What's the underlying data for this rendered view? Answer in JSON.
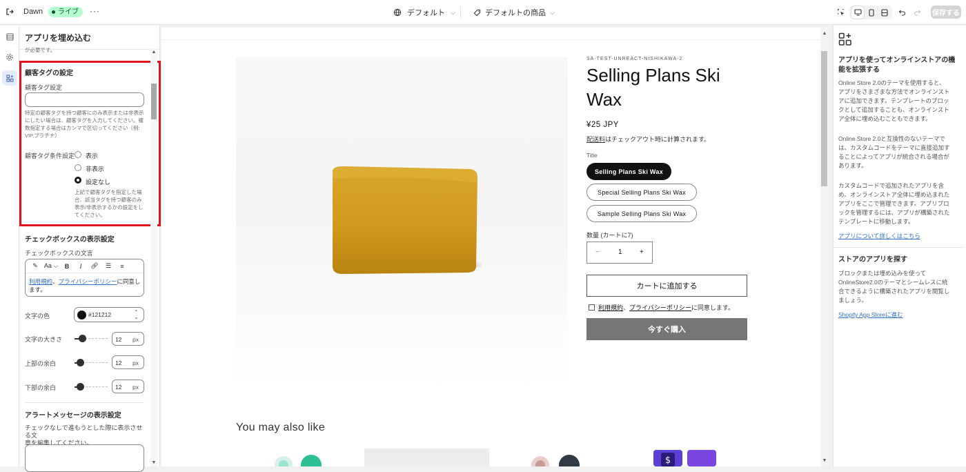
{
  "topbar": {
    "exit_icon": "exit-icon",
    "theme_name": "Dawn",
    "live_badge": "ライブ",
    "more_label": "···",
    "template_selector": "デフォルト",
    "product_selector": "デフォルトの商品",
    "save_label": "保存する"
  },
  "rail": {
    "items": [
      {
        "icon": "sections-icon",
        "active": false
      },
      {
        "icon": "settings-gear-icon",
        "active": false
      },
      {
        "icon": "app-embeds-icon",
        "active": true
      }
    ]
  },
  "left_panel": {
    "title": "アプリを埋め込む",
    "clipped_text": "が必要です。",
    "customer_tag": {
      "heading": "顧客タグの設定",
      "field_label": "顧客タグ設定",
      "field_value": "",
      "help_lines": [
        "特定の顧客タグを持つ顧客にのみ表示または非表示",
        "にしたい場合は、顧客タグを入力してください。複",
        "数指定する場合はカンマで区切ってください（例:",
        "VIP,プラチナ）"
      ],
      "condition_label": "顧客タグ条件設定",
      "options": [
        "表示",
        "非表示",
        "設定なし"
      ],
      "selected": "設定なし",
      "condition_help_lines": [
        "上記で顧客タグを指定した場",
        "合、該当タグを持つ顧客のみ",
        "表示/非表示するかの設定をし",
        "てください。"
      ]
    },
    "checkbox": {
      "heading": "チェックボックスの表示設定",
      "text_label": "チェックボックスの文言",
      "toolbar": [
        "magic-icon",
        "Aa",
        "B",
        "I",
        "link-icon",
        "bullet-list-icon",
        "numbered-list-icon"
      ],
      "link1": "利用規約",
      "sep": "、",
      "link2": "プライバシーポリシー",
      "suffix": "に同意し",
      "suffix2": "ます。",
      "color_label": "文字の色",
      "color_value": "#121212",
      "size_label": "文字の大きさ",
      "size_value": "12",
      "top_margin_label": "上部の余白",
      "top_margin_value": "12",
      "bottom_margin_label": "下部の余白",
      "bottom_margin_value": "12",
      "unit": "px"
    },
    "alert": {
      "heading": "アラートメッセージの表示設定",
      "help_lines": [
        "チェックなしで進もうとした際に表示させる文",
        "章を編集してください。"
      ]
    }
  },
  "product": {
    "vendor": "SA-TEST-UNREACT-NISHIKAWA-2",
    "title_line1": "Selling Plans Ski",
    "title_line2": "Wax",
    "price": "¥25 JPY",
    "shipping_link": "配送料",
    "shipping_rest": "はチェックアウト時に計算されます。",
    "option_label": "Title",
    "options": [
      "Selling Plans Ski Wax",
      "Special Selling Plans Ski Wax",
      "Sample Selling Plans Ski Wax"
    ],
    "selected_option": "Selling Plans Ski Wax",
    "qty_label": "数量 (カートに7)",
    "qty_minus": "−",
    "qty_value": "1",
    "qty_plus": "+",
    "add_to_cart": "カートに追加する",
    "agree_link1": "利用規約",
    "agree_sep": "、",
    "agree_link2": "プライバシーポリシー",
    "agree_suffix": "に同意します。",
    "buy_now": "今すぐ購入",
    "may_also_like": "You may also like",
    "wax_color": "#d8a629"
  },
  "right_panel": {
    "heading1_line1": "アプリを使ってオンラインストアの機",
    "heading1_line2": "能を拡張する",
    "para1": [
      "Online Store 2.0のテーマを使用すると、",
      "アプリをさまざまな方法でオンラインスト",
      "アに追加できます。テンプレートのブロッ",
      "クとして追加することも、オンラインスト",
      "ア全体に埋め込むこともできます。"
    ],
    "para2": [
      "Online Store 2.0と互換性のないテーマで",
      "は、カスタムコードをテーマに直接追加す",
      "ることによってアプリが統合される場合が",
      "あります。"
    ],
    "para3": [
      "カスタムコードで追加されたアプリを含",
      "め、オンラインストア全体に埋め込まれた",
      "アプリをここで管理できます。アプリブロ",
      "ックを管理するには、アプリが構築された",
      "テンプレートに移動します。"
    ],
    "link1": "アプリについて詳しくはこちら",
    "heading2": "ストアのアプリを探す",
    "para4": [
      "ブロックまたは埋め込みを使って",
      "OnlineStore2.0のテーマとシームレスに統",
      "合できるように構築されたアプリを閲覧し",
      "ましょう。"
    ],
    "link2": "Shopify App Storeに進む"
  },
  "colors": {
    "highlight": "#e0141e",
    "link": "#2c6ecb",
    "live_badge_bg": "#b4fed2"
  }
}
